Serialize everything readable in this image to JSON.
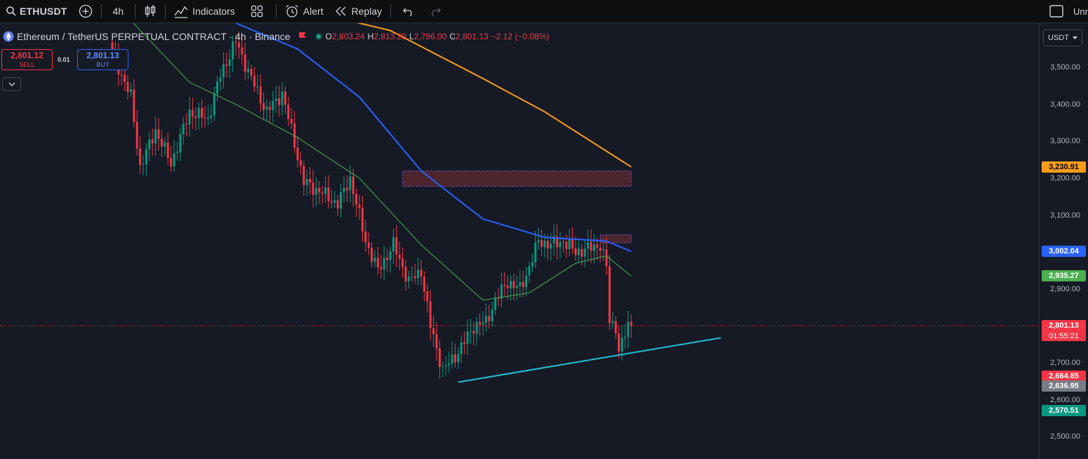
{
  "toolbar": {
    "symbol": "ETHUSDT",
    "interval": "4h",
    "indicators_label": "Indicators",
    "alert_label": "Alert",
    "replay_label": "Replay",
    "right_label": "Unr"
  },
  "legend": {
    "title": "Ethereum / TetherUS PERPETUAL CONTRACT · 4h · Binance",
    "o_label": "O",
    "o": "2,803.24",
    "h_label": "H",
    "h": "2,813.29",
    "l_label": "L",
    "l": "2,796.00",
    "c_label": "C",
    "c": "2,801.13",
    "change": "−2.12 (−0.08%)"
  },
  "trade": {
    "sell_price": "2,801.12",
    "sell_label": "SELL",
    "spread": "0.01",
    "buy_price": "2,801.13",
    "buy_label": "BUY"
  },
  "currency_select": "USDT",
  "price_axis": {
    "ticks": [
      {
        "label": "3,500.00",
        "value": 3500
      },
      {
        "label": "3,400.00",
        "value": 3400
      },
      {
        "label": "3,300.00",
        "value": 3300
      },
      {
        "label": "3,200.00",
        "value": 3200
      },
      {
        "label": "3,100.00",
        "value": 3100
      },
      {
        "label": "2,900.00",
        "value": 2900
      },
      {
        "label": "2,700.00",
        "value": 2700
      },
      {
        "label": "2,600.00",
        "value": 2600
      },
      {
        "label": "2,500.00",
        "value": 2500
      }
    ],
    "tags": [
      {
        "label": "3,230.91",
        "value": 3230.91,
        "color": "#f89c1c",
        "text": "#000000"
      },
      {
        "label": "3,002.04",
        "value": 3002.04,
        "color": "#2962ff",
        "text": "#ffffff"
      },
      {
        "label": "2,935.27",
        "value": 2935.27,
        "color": "#4caf50",
        "text": "#ffffff"
      },
      {
        "label": "2,801.13",
        "value": 2801.13,
        "color": "#f23645",
        "text": "#ffffff",
        "sub": "01:55:21"
      },
      {
        "label": "2,664.85",
        "value": 2664.85,
        "color": "#f23645",
        "text": "#ffffff"
      },
      {
        "label": "2,636.95",
        "value": 2636.95,
        "color": "#787b86",
        "text": "#ffffff"
      },
      {
        "label": "2,570.51",
        "value": 2570.51,
        "color": "#089981",
        "text": "#ffffff"
      }
    ]
  },
  "colors": {
    "up": "#089981",
    "down": "#f23645",
    "ma_orange": "#f89c1c",
    "ma_blue": "#2962ff",
    "ma_green": "#4caf50",
    "trendline": "#22c1d6",
    "zone": "#7a2e35"
  },
  "chart_data": {
    "type": "candlestick",
    "symbol": "ETHUSDT",
    "interval": "4h",
    "ylim": [
      2440,
      3620
    ],
    "last_price": 2801.13,
    "current_candle": {
      "open": 2803.24,
      "high": 2813.29,
      "low": 2796.0,
      "close": 2801.13
    },
    "anchor_points": [
      {
        "bar": 0,
        "close": 3540
      },
      {
        "bar": 6,
        "close": 3420
      },
      {
        "bar": 9,
        "close": 3230
      },
      {
        "bar": 14,
        "close": 3330
      },
      {
        "bar": 19,
        "close": 3240
      },
      {
        "bar": 25,
        "close": 3380
      },
      {
        "bar": 31,
        "close": 3360
      },
      {
        "bar": 35,
        "close": 3480
      },
      {
        "bar": 40,
        "close": 3570
      },
      {
        "bar": 45,
        "close": 3470
      },
      {
        "bar": 50,
        "close": 3380
      },
      {
        "bar": 55,
        "close": 3430
      },
      {
        "bar": 58,
        "close": 3330
      },
      {
        "bar": 62,
        "close": 3190
      },
      {
        "bar": 68,
        "close": 3160
      },
      {
        "bar": 73,
        "close": 3130
      },
      {
        "bar": 77,
        "close": 3200
      },
      {
        "bar": 82,
        "close": 3030
      },
      {
        "bar": 86,
        "close": 2950
      },
      {
        "bar": 91,
        "close": 3020
      },
      {
        "bar": 96,
        "close": 2920
      },
      {
        "bar": 100,
        "close": 2950
      },
      {
        "bar": 103,
        "close": 2800
      },
      {
        "bar": 107,
        "close": 2680
      },
      {
        "bar": 112,
        "close": 2730
      },
      {
        "bar": 117,
        "close": 2800
      },
      {
        "bar": 121,
        "close": 2810
      },
      {
        "bar": 124,
        "close": 2870
      },
      {
        "bar": 128,
        "close": 2920
      },
      {
        "bar": 132,
        "close": 2900
      },
      {
        "bar": 135,
        "close": 2960
      },
      {
        "bar": 138,
        "close": 3030
      },
      {
        "bar": 142,
        "close": 3020
      },
      {
        "bar": 146,
        "close": 3030
      },
      {
        "bar": 150,
        "close": 3000
      },
      {
        "bar": 154,
        "close": 3010
      },
      {
        "bar": 158,
        "close": 3020
      },
      {
        "bar": 160,
        "close": 2960
      },
      {
        "bar": 161,
        "close": 2810
      },
      {
        "bar": 163,
        "close": 2800
      },
      {
        "bar": 164,
        "close": 2730
      },
      {
        "bar": 167,
        "close": 2800
      },
      {
        "bar": 168,
        "close": 2801.13
      }
    ],
    "moving_averages": [
      {
        "color": "orange",
        "points": [
          [
            60,
            3660
          ],
          [
            90,
            3600
          ],
          [
            120,
            3470
          ],
          [
            140,
            3380
          ],
          [
            155,
            3300
          ],
          [
            168,
            3230.91
          ]
        ]
      },
      {
        "color": "blue",
        "points": [
          [
            40,
            3620
          ],
          [
            60,
            3550
          ],
          [
            80,
            3420
          ],
          [
            100,
            3220
          ],
          [
            120,
            3090
          ],
          [
            140,
            3040
          ],
          [
            160,
            3030
          ],
          [
            168,
            3002.04
          ]
        ]
      },
      {
        "color": "green",
        "points": [
          [
            0,
            3680
          ],
          [
            25,
            3460
          ],
          [
            40,
            3400
          ],
          [
            60,
            3310
          ],
          [
            80,
            3200
          ],
          [
            100,
            3020
          ],
          [
            120,
            2870
          ],
          [
            135,
            2890
          ],
          [
            150,
            2970
          ],
          [
            160,
            2990
          ],
          [
            168,
            2935.27
          ]
        ]
      }
    ],
    "zones": [
      {
        "bar_start": 94,
        "bar_end": 168,
        "top": 3220,
        "bottom": 3178
      },
      {
        "bar_start": 158,
        "bar_end": 168,
        "top": 3047,
        "bottom": 3025
      }
    ],
    "trendline": {
      "from": {
        "bar": 112,
        "price": 2648
      },
      "to": {
        "bar": 197,
        "price": 2768
      }
    }
  }
}
